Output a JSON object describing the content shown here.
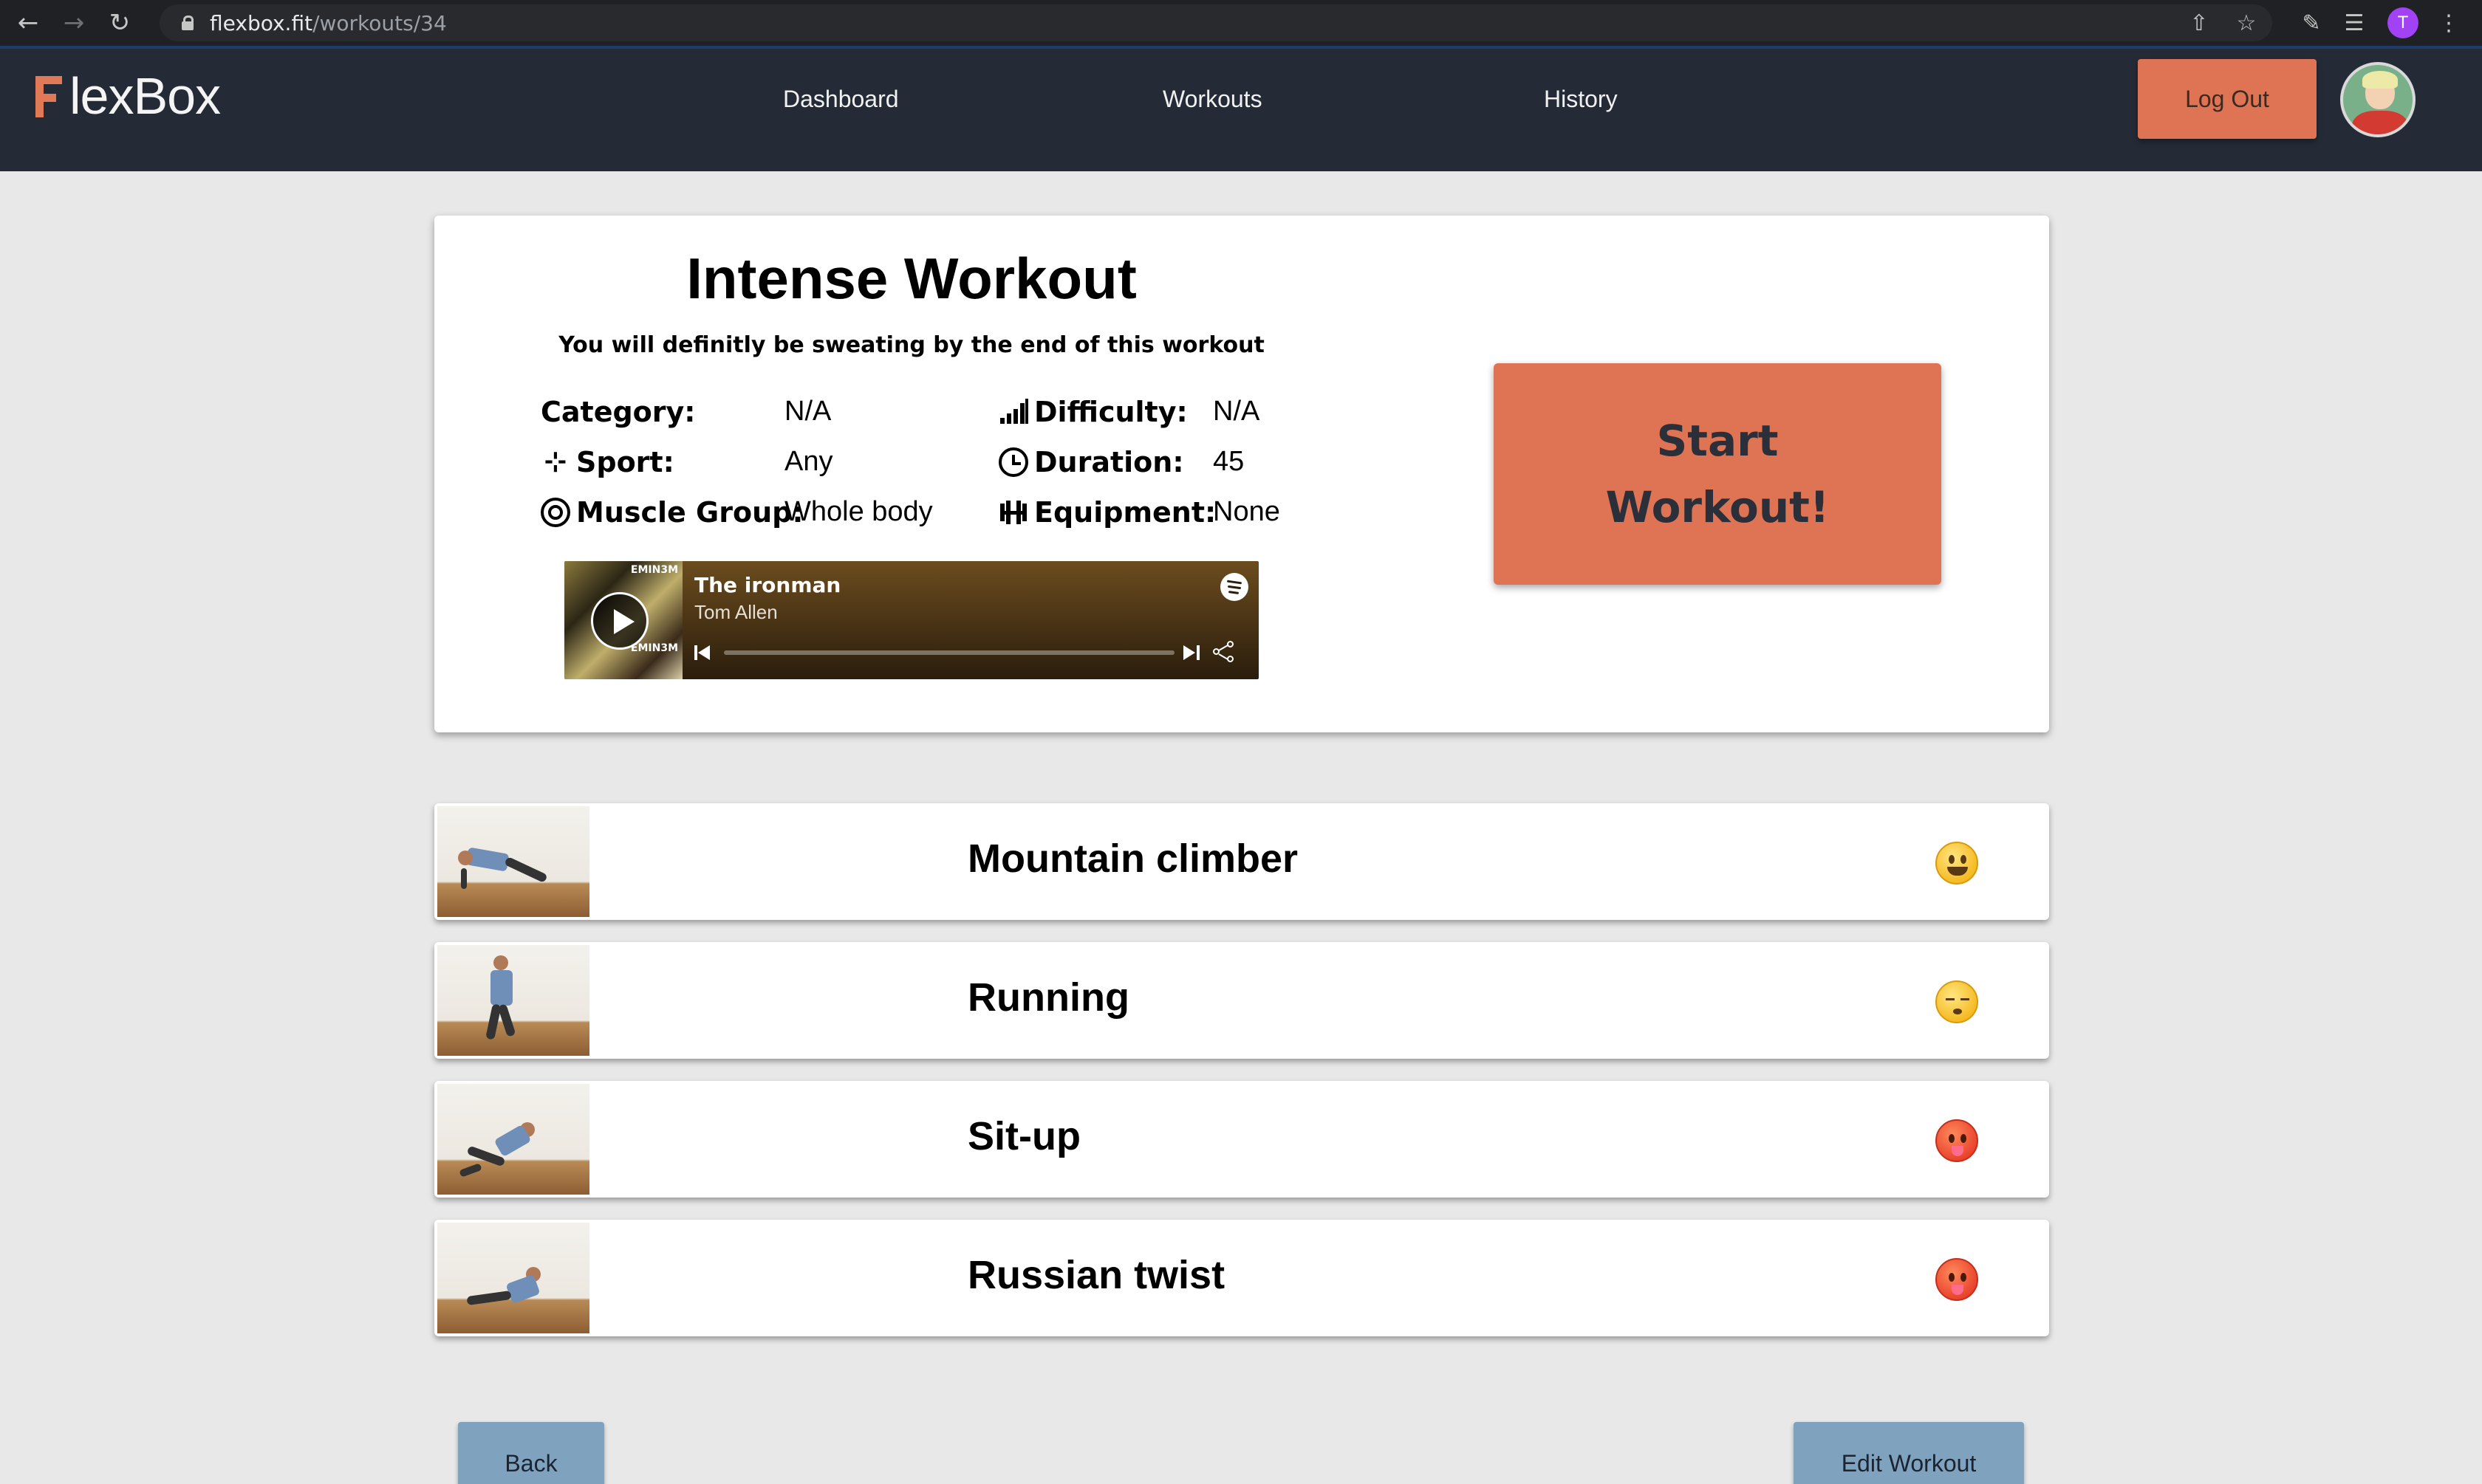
{
  "browser": {
    "url_host": "flexbox.fit",
    "url_path": "/workouts/34",
    "profile_initial": "T"
  },
  "header": {
    "logo_text": "lexBox",
    "nav": [
      "Dashboard",
      "Workouts",
      "History"
    ],
    "logout_label": "Log Out"
  },
  "workout": {
    "title": "Intense Workout",
    "description": "You will definitly be sweating by the end of this workout",
    "attributes": {
      "category_label": "Category:",
      "category_value": "N/A",
      "sport_label": "Sport:",
      "sport_value": "Any",
      "muscle_label": "Muscle Group:",
      "muscle_value": "Whole body",
      "difficulty_label": "Difficulty:",
      "difficulty_value": "N/A",
      "duration_label": "Duration:",
      "duration_value": "45",
      "equipment_label": "Equipment:",
      "equipment_value": "None"
    },
    "start_line1": "Start",
    "start_line2": "Workout!"
  },
  "spotify": {
    "track": "The ironman",
    "artist": "Tom Allen",
    "album_label": "EMIN3M",
    "progress": 0.0
  },
  "exercises": [
    {
      "name": "Mountain climber",
      "mood": "happy-face-icon"
    },
    {
      "name": "Running",
      "mood": "sleepy-face-icon"
    },
    {
      "name": "Sit-up",
      "mood": "hot-face-icon"
    },
    {
      "name": "Russian twist",
      "mood": "hot-face-icon"
    }
  ],
  "footer": {
    "back_label": "Back",
    "edit_label": "Edit Workout"
  },
  "colors": {
    "accent": "#df7454",
    "header_bg": "#242b37",
    "page_bg": "#e8e8e8",
    "secondary_button": "#7fa3bf"
  }
}
